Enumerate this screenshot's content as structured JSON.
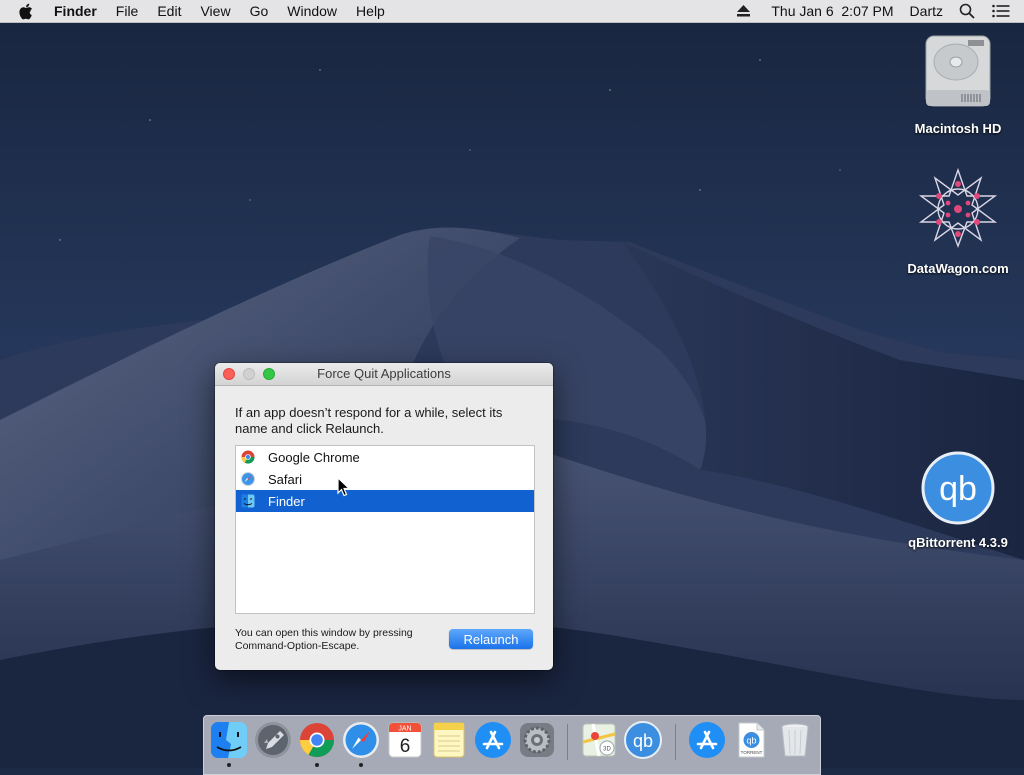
{
  "menubar": {
    "app_name": "Finder",
    "menus": [
      "File",
      "Edit",
      "View",
      "Go",
      "Window",
      "Help"
    ],
    "clock": "Thu Jan 6  2:07 PM",
    "user": "Dartz",
    "icons": [
      "apple-icon",
      "eject-icon",
      "spotlight-search-icon",
      "notification-center-icon"
    ]
  },
  "desktop": {
    "icons": [
      {
        "label": "Macintosh HD",
        "icon": "hard-drive-icon"
      },
      {
        "label": "DataWagon.com",
        "icon": "datawagon-logo-icon"
      },
      {
        "label": "qBittorrent 4.3.9",
        "icon": "qbittorrent-icon"
      }
    ]
  },
  "force_quit": {
    "title": "Force Quit Applications",
    "instructions": "If an app doesn’t respond for a while, select its name and click Relaunch.",
    "apps": [
      {
        "name": "Google Chrome",
        "icon": "chrome-icon",
        "selected": false
      },
      {
        "name": "Safari",
        "icon": "safari-icon",
        "selected": false
      },
      {
        "name": "Finder",
        "icon": "finder-icon",
        "selected": true
      }
    ],
    "footer_line1": "You can open this window by pressing",
    "footer_line2": "Command-Option-Escape.",
    "button_label": "Relaunch"
  },
  "dock": {
    "items": [
      {
        "name": "finder",
        "icon": "finder-icon",
        "running": true
      },
      {
        "name": "launchpad",
        "icon": "launchpad-icon",
        "running": false
      },
      {
        "name": "google-chrome",
        "icon": "chrome-icon",
        "running": true
      },
      {
        "name": "safari",
        "icon": "safari-icon",
        "running": true
      },
      {
        "name": "calendar",
        "icon": "calendar-icon",
        "running": false,
        "month": "JAN",
        "day": "6"
      },
      {
        "name": "notes",
        "icon": "notes-icon",
        "running": false
      },
      {
        "name": "app-store",
        "icon": "app-store-icon",
        "running": false
      },
      {
        "name": "system-preferences",
        "icon": "gear-icon",
        "running": false
      },
      {
        "name": "maps",
        "icon": "maps-icon",
        "running": false,
        "badge": "3D"
      },
      {
        "name": "qbittorrent",
        "icon": "qbittorrent-icon",
        "running": false
      },
      {
        "name": "app-store-download",
        "icon": "app-store-icon",
        "running": false
      },
      {
        "name": "torrent-file",
        "icon": "torrent-document-icon",
        "running": false,
        "caption": "TORRENT"
      },
      {
        "name": "trash",
        "icon": "trash-icon",
        "running": false
      }
    ]
  },
  "colors": {
    "selection": "#1261d1",
    "button": "#1a73ea",
    "close": "#fc5f57",
    "zoom": "#33c748"
  }
}
